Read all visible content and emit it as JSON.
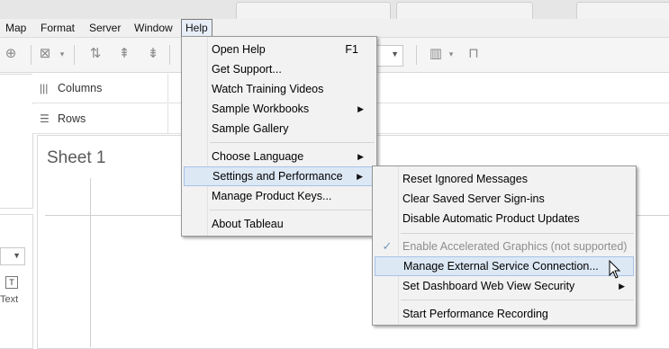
{
  "menubar": {
    "items": [
      {
        "label": "Map"
      },
      {
        "label": "Format"
      },
      {
        "label": "Server"
      },
      {
        "label": "Window"
      },
      {
        "label": "Help"
      }
    ],
    "active": "Help"
  },
  "toolbar": {
    "icons": [
      "add-datasource-icon",
      "remove-datasource-icon",
      "swap-icon",
      "sort-ascending-icon",
      "sort-descending-icon",
      "show-me-icon",
      "presentation-icon"
    ]
  },
  "shelves": {
    "columns_label": "Columns",
    "rows_label": "Rows"
  },
  "sheet": {
    "title": "Sheet 1"
  },
  "left_panel": {
    "text_label": "Text",
    "text_icon_glyph": "T"
  },
  "help_menu": {
    "items": [
      {
        "label": "Open Help",
        "shortcut": "F1"
      },
      {
        "label": "Get Support..."
      },
      {
        "label": "Watch Training Videos"
      },
      {
        "label": "Sample Workbooks",
        "submenu": true
      },
      {
        "label": "Sample Gallery"
      },
      {
        "label": "Choose Language",
        "submenu": true
      },
      {
        "label": "Settings and Performance",
        "submenu": true,
        "highlighted": true
      },
      {
        "label": "Manage Product Keys..."
      },
      {
        "label": "About Tableau"
      }
    ]
  },
  "settings_submenu": {
    "items": [
      {
        "label": "Reset Ignored Messages"
      },
      {
        "label": "Clear Saved Server Sign-ins"
      },
      {
        "label": "Disable Automatic Product Updates"
      },
      {
        "label": "Enable Accelerated Graphics (not supported)",
        "checked": true,
        "disabled": true
      },
      {
        "label": "Manage External Service Connection...",
        "highlighted": true
      },
      {
        "label": "Set Dashboard Web View Security",
        "submenu": true
      },
      {
        "label": "Start Performance Recording"
      }
    ]
  },
  "colors": {
    "highlight_bg": "#dde8f5",
    "highlight_border": "#a8c3e6",
    "menu_bg": "#f2f2f2",
    "disabled_text": "#8d8d8d"
  }
}
